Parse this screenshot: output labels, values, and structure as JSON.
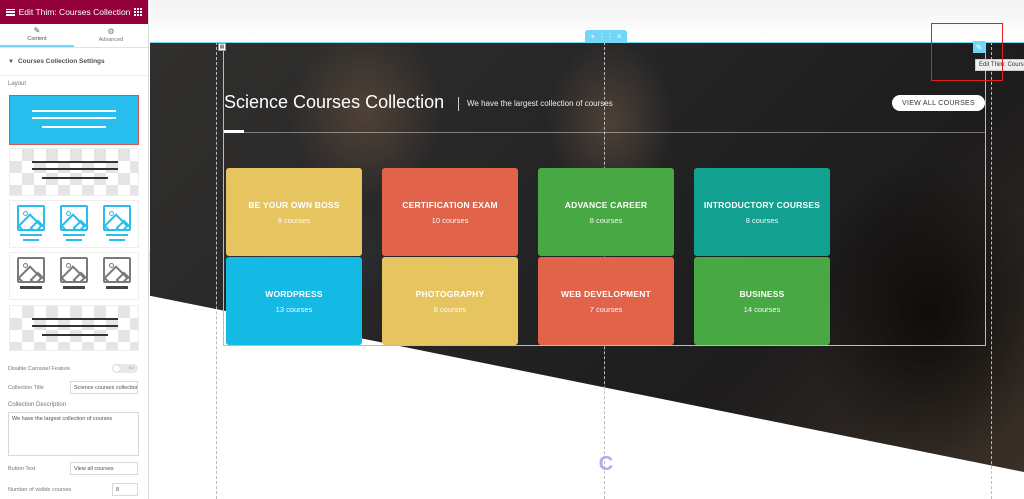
{
  "sidebar": {
    "header_title": "Edit Thim: Courses Collection",
    "tabs": [
      {
        "label": "Content"
      },
      {
        "label": "Advanced"
      }
    ],
    "section_title": "Courses Collection Settings",
    "layout_label": "Layout",
    "carousel_label": "Disable Carousel Feature",
    "carousel_toggle_text": "NO",
    "collection_title_label": "Collection Title",
    "collection_title_value": "Science courses collection",
    "collection_desc_label": "Collection Description",
    "collection_desc_value": "We have the largest collection of courses",
    "button_text_label": "Button Text",
    "button_text_value": "View all courses",
    "visible_courses_label": "Number of visible courses",
    "visible_courses_value": "8"
  },
  "canvas": {
    "collection_title": "Science Courses Collection",
    "collection_desc": "We have the largest collection of courses",
    "view_all_button": "VIEW ALL COURSES",
    "tooltip": "Edit Thim: Courses Collection",
    "tiles": [
      {
        "name": "Be your own boss",
        "count": "9 courses",
        "color": "#e6c460"
      },
      {
        "name": "Certification exam",
        "count": "10 courses",
        "color": "#e0634a"
      },
      {
        "name": "Advance career",
        "count": "8 courses",
        "color": "#47a844"
      },
      {
        "name": "Introductory courses",
        "count": "8 courses",
        "color": "#12a190"
      },
      {
        "name": "Wordpress",
        "count": "13 courses",
        "color": "#14b9e4"
      },
      {
        "name": "Photography",
        "count": "8 courses",
        "color": "#e6c460"
      },
      {
        "name": "Web Development",
        "count": "7 courses",
        "color": "#e0634a"
      },
      {
        "name": "Business",
        "count": "14 courses",
        "color": "#47a844"
      }
    ]
  },
  "colors": {
    "editor_header": "#93003c",
    "selection_accent": "#71d7f7",
    "layout_selected": "#27bdec",
    "highlight_red": "#e02020"
  }
}
